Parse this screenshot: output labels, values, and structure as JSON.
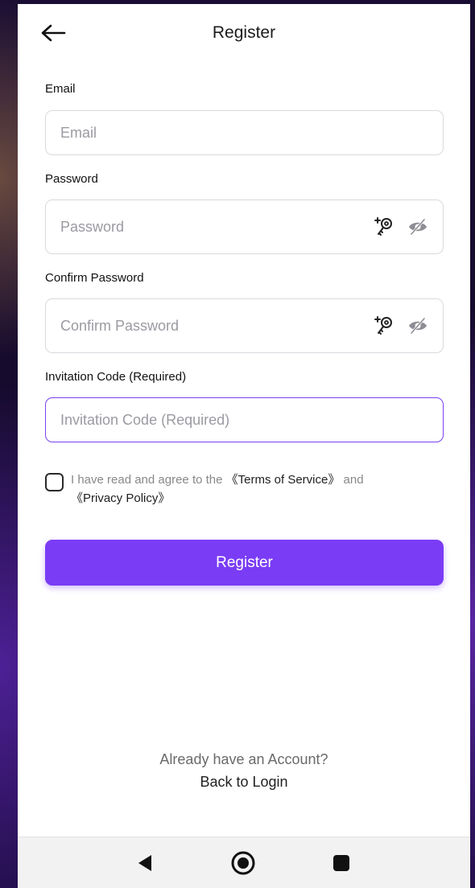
{
  "header": {
    "title": "Register",
    "back_icon": "arrow-left-icon"
  },
  "form": {
    "email": {
      "label": "Email",
      "placeholder": "Email",
      "value": ""
    },
    "password": {
      "label": "Password",
      "placeholder": "Password",
      "value": "",
      "icons": [
        "key-generate-icon",
        "eye-off-icon"
      ]
    },
    "confirm_password": {
      "label": "Confirm Password",
      "placeholder": "Confirm Password",
      "value": "",
      "icons": [
        "key-generate-icon",
        "eye-off-icon"
      ]
    },
    "invitation_code": {
      "label": "Invitation Code (Required)",
      "placeholder": "Invitation Code (Required)",
      "value": ""
    }
  },
  "agreement": {
    "checked": false,
    "prefix": "I have read and agree to the ",
    "terms": "《Terms of Service》",
    "and": " and ",
    "privacy": "《Privacy Policy》"
  },
  "register_button": {
    "label": "Register"
  },
  "footer": {
    "prompt": "Already have an Account?",
    "link": "Back to Login"
  },
  "colors": {
    "accent": "#7a3cf5",
    "border": "#d9d9e0",
    "active_border": "#7b3ff2"
  }
}
